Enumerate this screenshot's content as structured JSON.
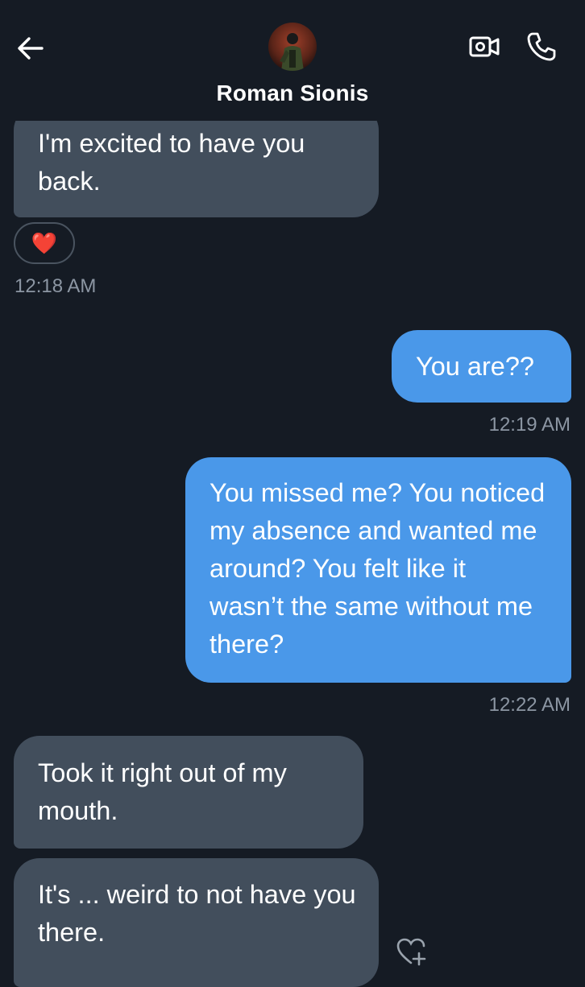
{
  "header": {
    "contact_name": "Roman Sionis"
  },
  "icons": {
    "back": "arrow-left-icon",
    "video": "video-camera-icon",
    "call": "phone-icon",
    "reaction": "red-heart-emoji",
    "add_reaction": "heart-plus-icon"
  },
  "colors": {
    "background": "#151b24",
    "received_bubble": "#424e5c",
    "sent_bubble": "#4a98e9",
    "timestamp": "#8c96a3"
  },
  "messages": [
    {
      "direction": "received",
      "text": "I'm excited to have you back.",
      "reaction": "❤️",
      "time": "12:18 AM"
    },
    {
      "direction": "sent",
      "text": "You are??",
      "time": "12:19 AM"
    },
    {
      "direction": "sent",
      "text": "You missed me? You noticed my absence and wanted me around? You felt like it wasn’t the same without me there?",
      "time": "12:22 AM"
    },
    {
      "direction": "received",
      "text": "Took it right out of my mouth."
    },
    {
      "direction": "received",
      "text": "It's ... weird to not have you there."
    }
  ]
}
